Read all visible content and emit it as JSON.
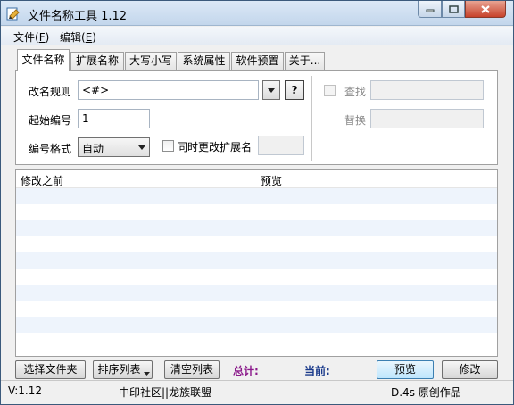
{
  "window": {
    "title": "文件名称工具 1.12"
  },
  "menu": {
    "file_label": "文件(",
    "file_key": "F",
    "edit_label": "编辑(",
    "edit_key": "E",
    "close_paren": ")"
  },
  "tabs": [
    {
      "label": "文件名称",
      "active": true
    },
    {
      "label": "扩展名称",
      "active": false
    },
    {
      "label": "大写小写",
      "active": false
    },
    {
      "label": "系统属性",
      "active": false
    },
    {
      "label": "软件预置",
      "active": false
    },
    {
      "label": "关于...",
      "active": false
    }
  ],
  "form": {
    "rule_label": "改名规则",
    "rule_value": "<#>",
    "help_label": "?",
    "start_label": "起始编号",
    "start_value": "1",
    "format_label": "编号格式",
    "format_value": "自动",
    "change_ext_label": "同时更改扩展名",
    "change_ext_value": "",
    "find_label": "查找",
    "find_value": "",
    "replace_label": "替换",
    "replace_value": ""
  },
  "list": {
    "columns": [
      "修改之前",
      "预览"
    ],
    "rows": []
  },
  "buttons": {
    "select_files": "选择文件夹",
    "sort_list": "排序列表",
    "clear_list": "清空列表",
    "preview": "预览",
    "modify": "修改"
  },
  "stats": {
    "total_label": "总计:",
    "current_label": "当前:"
  },
  "colors": {
    "total": "#8b1a8b",
    "current": "#1a3a8b"
  },
  "statusbar": {
    "version": "V:1.12",
    "community": "中印社区||龙族联盟",
    "credit": "D.4s 原创作品"
  }
}
